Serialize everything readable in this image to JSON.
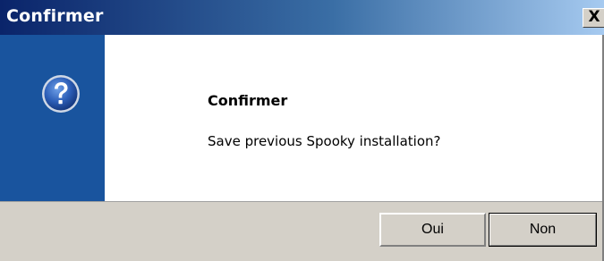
{
  "window": {
    "title": "Confirmer",
    "close_label": "X"
  },
  "dialog": {
    "icon": "question-icon",
    "heading": "Confirmer",
    "message": "Save previous Spooky installation?",
    "sidebar_color": "#19549e"
  },
  "buttons": {
    "yes_label": "Oui",
    "no_label": "Non"
  }
}
